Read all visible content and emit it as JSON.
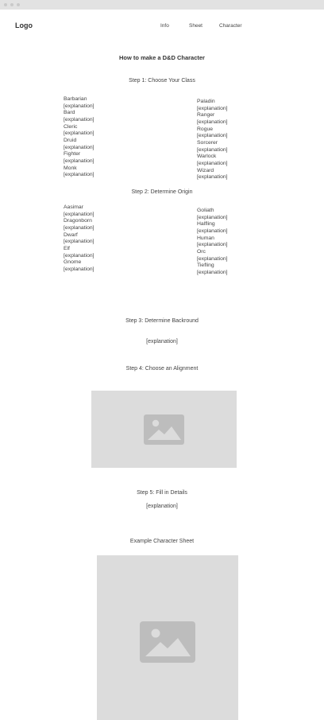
{
  "header": {
    "logo": "Logo",
    "nav": [
      {
        "label": "Info"
      },
      {
        "label": "Sheet"
      },
      {
        "label": "Character"
      }
    ]
  },
  "main": {
    "title": "How to make a D&D Character",
    "step1": {
      "heading": "Step 1: Choose Your Class",
      "left": [
        "Barbarian",
        "[explanation]",
        "Bard",
        "[explanation]",
        "Cleric",
        "[explanation]",
        "Druid",
        "[explanation]",
        "Fighter",
        "[explanation]",
        "Monk",
        "[explanation]"
      ],
      "right": [
        "Paladin",
        "[explanation]",
        "Ranger",
        "[explanation]",
        "Rogue",
        "[explanation]",
        "Sorcerer",
        "[explanation]",
        "Warlock",
        "[explanation]",
        "Wizard",
        "[explanation]"
      ]
    },
    "step2": {
      "heading": "Step 2: Determine Origin",
      "left": [
        "Aasimar",
        "[explanation]",
        "Dragonborn",
        "[explanation]",
        "Dwarf",
        "[explanation]",
        "Elf",
        "[explanation]",
        "Gnome",
        "[explanation]"
      ],
      "right": [
        "Goliath",
        "[explanation]",
        "Halfling",
        "[explanation]",
        "Human",
        "[explanation]",
        "Orc",
        "[explanation]",
        "Tiefling",
        "[explanation]"
      ]
    },
    "step3": {
      "heading": "Step 3: Determine Backround",
      "text": "[explanation]"
    },
    "step4": {
      "heading": "Step 4: Choose an Alignment"
    },
    "step5": {
      "heading": "Step 5: Fill in Details",
      "text": "[explanation]"
    },
    "example": {
      "heading": "Example Character Sheet"
    }
  },
  "icons": {
    "placeholder": "image-placeholder-icon"
  }
}
